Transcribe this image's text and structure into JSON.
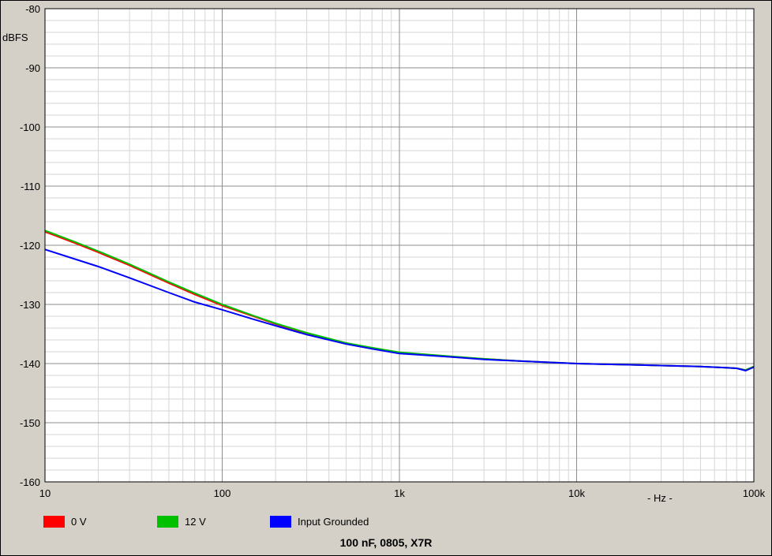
{
  "chart_data": {
    "type": "line",
    "title": "100 nF, 0805,  X7R",
    "xlabel": "- Hz -",
    "ylabel": "dBFS",
    "xscale": "log",
    "xlim": [
      10,
      100000
    ],
    "ylim": [
      -160,
      -80
    ],
    "grid": true,
    "legend_position": "bottom-left",
    "x_ticks": [
      {
        "value": 10,
        "label": "10"
      },
      {
        "value": 100,
        "label": "100"
      },
      {
        "value": 1000,
        "label": "1k"
      },
      {
        "value": 10000,
        "label": "10k"
      },
      {
        "value": 100000,
        "label": "100k"
      }
    ],
    "y_ticks": [
      {
        "value": -80,
        "label": "-80"
      },
      {
        "value": -90,
        "label": "-90"
      },
      {
        "value": -100,
        "label": "-100"
      },
      {
        "value": -110,
        "label": "-110"
      },
      {
        "value": -120,
        "label": "-120"
      },
      {
        "value": -130,
        "label": "-130"
      },
      {
        "value": -140,
        "label": "-140"
      },
      {
        "value": -150,
        "label": "-150"
      },
      {
        "value": -160,
        "label": "-160"
      }
    ],
    "series": [
      {
        "name": "0 V",
        "color": "#ff0000",
        "x": [
          10,
          15,
          20,
          30,
          50,
          70,
          100,
          150,
          200,
          300,
          500,
          700,
          1000,
          2000,
          3000,
          5000,
          10000,
          20000,
          50000,
          70000,
          80000,
          90000,
          100000
        ],
        "y": [
          -117.7,
          -119.7,
          -121.2,
          -123.4,
          -126.4,
          -128.3,
          -130.2,
          -132.0,
          -133.3,
          -134.9,
          -136.6,
          -137.4,
          -138.2,
          -138.9,
          -139.2,
          -139.6,
          -140.0,
          -140.2,
          -140.5,
          -140.7,
          -140.8,
          -141.1,
          -140.5
        ]
      },
      {
        "name": "12 V",
        "color": "#00c000",
        "x": [
          10,
          15,
          20,
          30,
          50,
          70,
          100,
          150,
          200,
          300,
          500,
          700,
          1000,
          2000,
          3000,
          5000,
          10000,
          20000,
          50000,
          70000,
          80000,
          90000,
          100000
        ],
        "y": [
          -117.5,
          -119.5,
          -121.0,
          -123.2,
          -126.2,
          -128.1,
          -130.0,
          -131.9,
          -133.2,
          -134.8,
          -136.5,
          -137.3,
          -138.1,
          -138.8,
          -139.2,
          -139.6,
          -140.0,
          -140.2,
          -140.5,
          -140.7,
          -140.8,
          -141.1,
          -140.5
        ]
      },
      {
        "name": "Input Grounded",
        "color": "#0000ff",
        "x": [
          10,
          15,
          20,
          30,
          50,
          70,
          100,
          150,
          200,
          300,
          500,
          700,
          1000,
          2000,
          3000,
          5000,
          10000,
          20000,
          50000,
          70000,
          80000,
          90000,
          100000
        ],
        "y": [
          -120.7,
          -122.4,
          -123.6,
          -125.5,
          -128.0,
          -129.6,
          -130.9,
          -132.5,
          -133.6,
          -135.1,
          -136.7,
          -137.5,
          -138.3,
          -138.9,
          -139.3,
          -139.6,
          -140.0,
          -140.2,
          -140.5,
          -140.7,
          -140.8,
          -141.2,
          -140.6
        ]
      }
    ]
  },
  "legend": [
    {
      "label": "0 V",
      "color": "#ff0000"
    },
    {
      "label": "12 V",
      "color": "#00c000"
    },
    {
      "label": "Input Grounded",
      "color": "#0000ff"
    }
  ]
}
